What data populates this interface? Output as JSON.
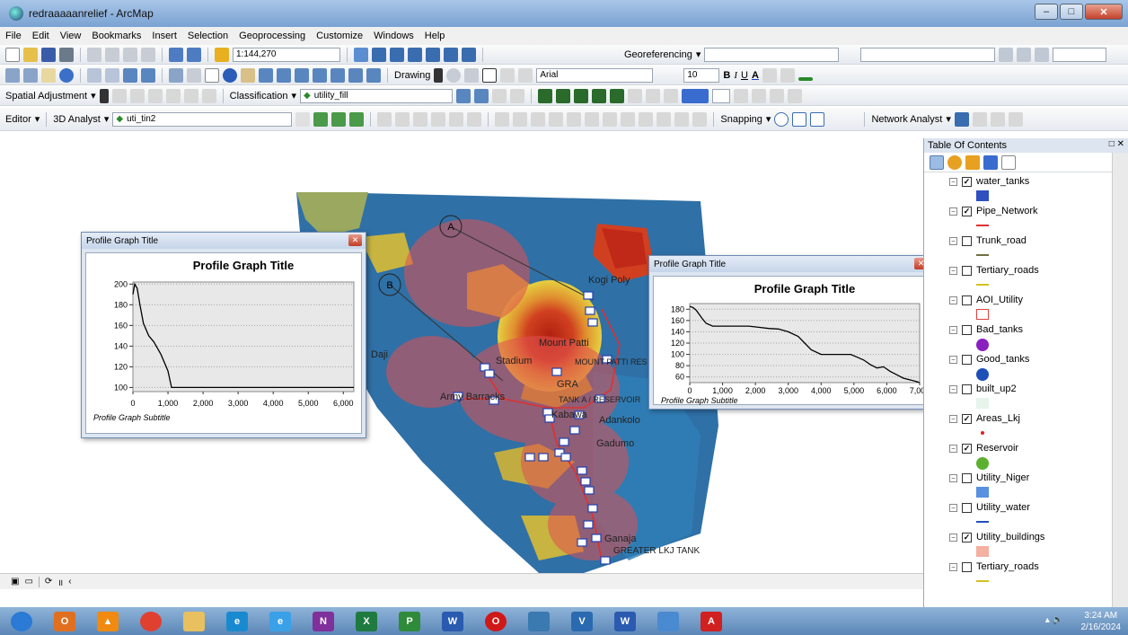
{
  "window": {
    "title": "redraaaaanrelief - ArcMap",
    "minimize_icon": "minimize-icon",
    "maximize_icon": "maximize-icon",
    "close_icon": "close-icon"
  },
  "menu": [
    "File",
    "Edit",
    "View",
    "Bookmarks",
    "Insert",
    "Selection",
    "Geoprocessing",
    "Customize",
    "Windows",
    "Help"
  ],
  "toolbar1": {
    "scale": "1:144,270",
    "georef_label": "Georeferencing"
  },
  "toolbar2": {
    "drawing_label": "Drawing",
    "font_name": "Arial",
    "font_size": "10",
    "bold": "B",
    "italic": "I",
    "underline": "U",
    "font_color": "A"
  },
  "toolbar3": {
    "spatial_adjustment": "Spatial Adjustment",
    "classification": "Classification",
    "layer_combo": "utility_fill"
  },
  "toolbar4": {
    "editor": "Editor",
    "analyst_3d": "3D Analyst",
    "tin_combo": "uti_tin2",
    "snapping": "Snapping",
    "network_analyst": "Network Analyst"
  },
  "map": {
    "labels": {
      "kogi_poly": "Kogi Poly",
      "mount_patti": "Mount Patti",
      "mount_patti_res": "MOUNT PATTI RES",
      "daji": "Daji",
      "stadium": "Stadium",
      "gra": "GRA",
      "army_barracks": "Army Barracks",
      "tank_reservoir": "TANK A / RESERVOIR",
      "kabawa": "Kabawa",
      "adankolo": "Adankolo",
      "gadumo": "Gadumo",
      "ganaja": "Ganaja",
      "greater_lkj_tank": "GREATER LKJ TANK"
    },
    "markers": {
      "a": "A",
      "b": "B"
    }
  },
  "profile_a": {
    "window_title": "Profile Graph Title",
    "chart_data": {
      "type": "line",
      "title": "Profile Graph Title",
      "subtitle": "Profile Graph Subtitle",
      "xlim": [
        0,
        7000
      ],
      "ylim": [
        50,
        190
      ],
      "x_ticks": [
        "0",
        "1,000",
        "2,000",
        "3,000",
        "4,000",
        "5,000",
        "6,000",
        "7,000"
      ],
      "y_ticks": [
        "180",
        "160",
        "140",
        "120",
        "100",
        "80",
        "60"
      ],
      "grid": true,
      "x": [
        0,
        100,
        200,
        300,
        400,
        500,
        700,
        900,
        1200,
        1500,
        1800,
        2100,
        2400,
        2700,
        3000,
        3300,
        3500,
        3700,
        4000,
        4300,
        4600,
        4900,
        5100,
        5300,
        5500,
        5700,
        5900,
        6100,
        6300,
        6500,
        6700,
        6900,
        7000
      ],
      "y": [
        185,
        183,
        178,
        170,
        162,
        155,
        150,
        150,
        150,
        150,
        150,
        148,
        146,
        145,
        140,
        132,
        120,
        108,
        100,
        100,
        100,
        100,
        95,
        90,
        82,
        76,
        78,
        70,
        64,
        58,
        55,
        52,
        50
      ]
    }
  },
  "profile_b": {
    "window_title": "Profile Graph Title",
    "chart_data": {
      "type": "line",
      "title": "Profile Graph Title",
      "subtitle": "Profile Graph Subtitle",
      "xlim": [
        0,
        6300
      ],
      "ylim": [
        96,
        202
      ],
      "x_ticks": [
        "0",
        "1,000",
        "2,000",
        "3,000",
        "4,000",
        "5,000",
        "6,000"
      ],
      "y_ticks": [
        "200",
        "180",
        "160",
        "140",
        "120",
        "100"
      ],
      "grid": true,
      "x": [
        0,
        50,
        120,
        200,
        300,
        450,
        600,
        800,
        1000,
        1100,
        1500,
        2000,
        3000,
        4000,
        5000,
        6000,
        6300
      ],
      "y": [
        190,
        200,
        196,
        180,
        162,
        150,
        144,
        132,
        116,
        100,
        100,
        100,
        100,
        100,
        100,
        100,
        100
      ]
    }
  },
  "toc": {
    "title": "Table Of Contents",
    "layers": [
      {
        "name": "water_tanks",
        "checked": true,
        "sym_color": "#3050c0"
      },
      {
        "name": "Pipe_Network",
        "checked": true,
        "sym_color": "#e03030"
      },
      {
        "name": "Trunk_road",
        "checked": false,
        "sym_color": "#707040"
      },
      {
        "name": "Tertiary_roads",
        "checked": false,
        "sym_color": "#d4c020"
      },
      {
        "name": "AOI_Utility",
        "checked": false,
        "sym_color": "#e04040"
      },
      {
        "name": "Bad_tanks",
        "checked": false,
        "sym_color": "#8a1fc0"
      },
      {
        "name": "Good_tanks",
        "checked": false,
        "sym_color": "#1d4fb8"
      },
      {
        "name": "built_up2",
        "checked": false,
        "sym_color": "#e6f4ec"
      },
      {
        "name": "Areas_Lkj",
        "checked": true,
        "sym_color": "#e02020"
      },
      {
        "name": "Reservoir",
        "checked": true,
        "sym_color": "#5cb030"
      },
      {
        "name": "Utility_Niger",
        "checked": false,
        "sym_color": "#5a90e0"
      },
      {
        "name": "Utility_water",
        "checked": false,
        "sym_color": "#2050c0"
      },
      {
        "name": "Utility_buildings",
        "checked": true,
        "sym_color": "#f4b0a0"
      },
      {
        "name": "Tertiary_roads",
        "checked": false,
        "sym_color": "#d4c020"
      }
    ]
  },
  "taskbar": {
    "clock_time": "3:24 AM",
    "clock_date": "2/16/2024",
    "apps": [
      {
        "name": "start-orb",
        "color": "#2a7ad6",
        "text": ""
      },
      {
        "name": "outlook-icon",
        "color": "#e07020",
        "text": "O"
      },
      {
        "name": "vlc-icon",
        "color": "#f08a10",
        "text": "▲"
      },
      {
        "name": "chrome-icon",
        "color": "#e04030",
        "text": ""
      },
      {
        "name": "explorer-icon",
        "color": "#e8c060",
        "text": ""
      },
      {
        "name": "edge-icon",
        "color": "#1a8ad0",
        "text": "e"
      },
      {
        "name": "ie-icon",
        "color": "#3aa0e8",
        "text": "e"
      },
      {
        "name": "onenote-icon",
        "color": "#80309a",
        "text": "N"
      },
      {
        "name": "excel-icon",
        "color": "#1f7a40",
        "text": "X"
      },
      {
        "name": "project-icon",
        "color": "#2f8a3a",
        "text": "P"
      },
      {
        "name": "word-icon",
        "color": "#2a5bb0",
        "text": "W"
      },
      {
        "name": "opera-icon",
        "color": "#d01818",
        "text": "O"
      },
      {
        "name": "arcmap-icon",
        "color": "#3a7ab0",
        "text": ""
      },
      {
        "name": "visio-icon",
        "color": "#2a6ab0",
        "text": "V"
      },
      {
        "name": "word-active-icon",
        "color": "#2a5bb0",
        "text": "W"
      },
      {
        "name": "remote-desktop-icon",
        "color": "#4a8ad0",
        "text": ""
      },
      {
        "name": "acrobat-icon",
        "color": "#d02020",
        "text": "A"
      }
    ]
  }
}
